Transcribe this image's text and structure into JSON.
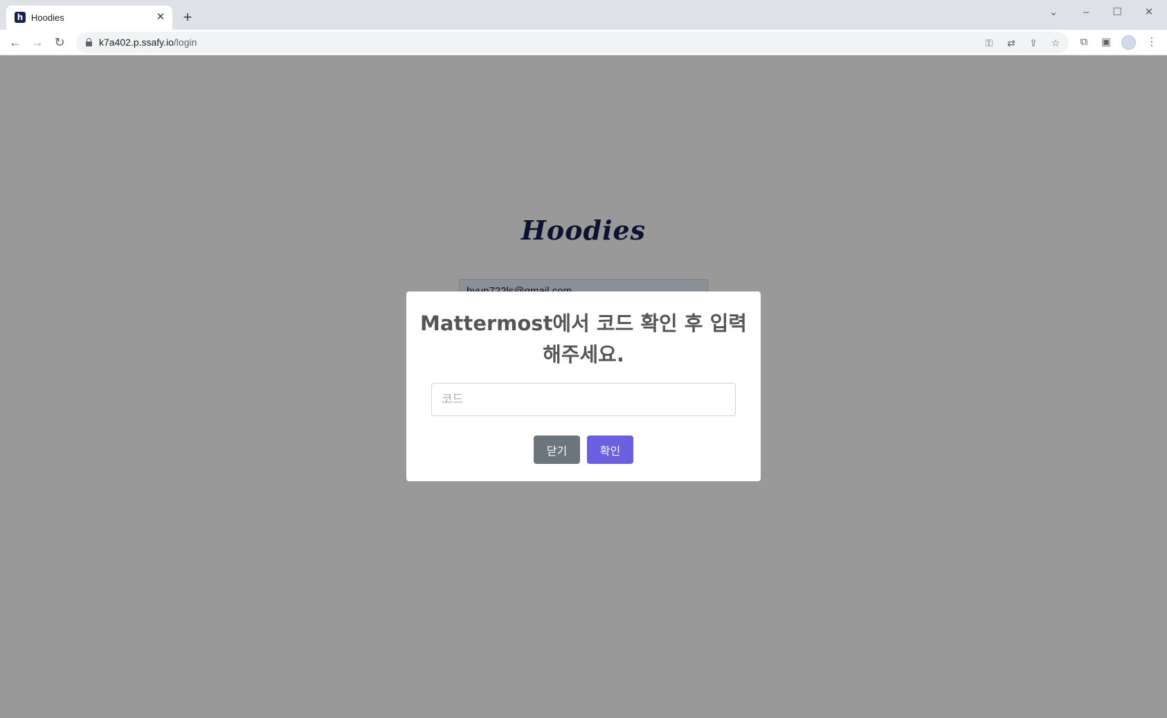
{
  "browser": {
    "tab_title": "Hoodies",
    "favicon_letter": "h",
    "url_host": "k7a402.p.ssafy.io",
    "url_path": "/login"
  },
  "page": {
    "brand": "Hoodies",
    "email_value": "hyun722ls@gmail.com"
  },
  "modal": {
    "title": "Mattermost에서 코드 확인 후 입력해주세요.",
    "code_placeholder": "코드",
    "close_label": "닫기",
    "confirm_label": "확인"
  },
  "colors": {
    "brand": "#16214f",
    "confirm_button": "#6a5fe0",
    "close_button": "#6c757d",
    "backdrop": "rgba(0,0,0,0.4)"
  }
}
